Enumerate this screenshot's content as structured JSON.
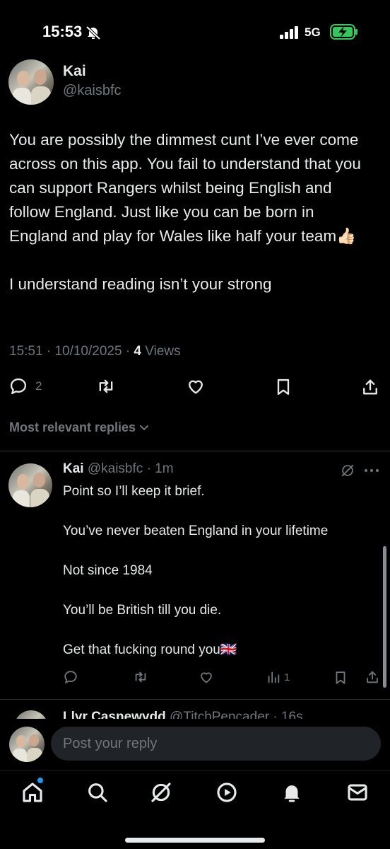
{
  "status": {
    "time": "15:53",
    "network": "5G"
  },
  "tweet": {
    "author_name": "Kai",
    "author_handle": "@kaisbfc",
    "paragraph1": "You are possibly the dimmest cunt I’ve ever come across on this app. You fail to understand that you can support Rangers whilst being English and follow England. Just like you can be born in England and play for Wales like half your team👍🏻",
    "paragraph2": "I understand reading isn’t your strong",
    "time": "15:51",
    "date": "10/10/2025",
    "views_count": "4",
    "views_label": "Views",
    "reply_count": "2"
  },
  "replies_filter": {
    "label": "Most relevant replies"
  },
  "reply": {
    "author_name": "Kai",
    "author_handle": "@kaisbfc",
    "age": "1m",
    "lines": [
      "Point so I’ll keep it brief.",
      "You’ve never beaten England in your lifetime",
      "Not since 1984",
      "You’ll be British till you die.",
      "Get that fucking round you🇬🇧"
    ],
    "views_count": "1"
  },
  "next_reply": {
    "author_name": "Llyr Casnewydd",
    "author_handle": "@TitchPencader",
    "age": "16s"
  },
  "composer": {
    "placeholder": "Post your reply"
  },
  "colors": {
    "background": "#000000",
    "text": "#e7e9ea",
    "muted": "#71767b",
    "accent": "#1d9bf0",
    "battery": "#34c759"
  },
  "icons": {
    "status": [
      "mute-bell-icon",
      "signal-icon",
      "battery-charging-icon"
    ],
    "tweet_actions": [
      "reply-icon",
      "repost-icon",
      "like-icon",
      "bookmark-icon",
      "share-icon"
    ],
    "reply_actions": [
      "reply-icon",
      "repost-icon",
      "like-icon",
      "views-icon",
      "bookmark-icon",
      "share-icon"
    ],
    "nav": [
      "home-icon",
      "search-icon",
      "grok-icon",
      "video-icon",
      "notifications-icon",
      "messages-icon"
    ]
  }
}
